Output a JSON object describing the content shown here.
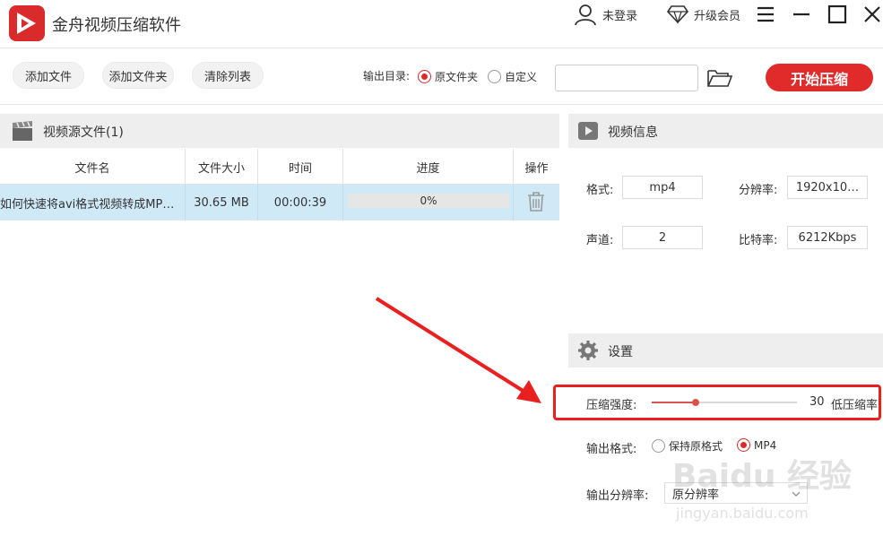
{
  "app": {
    "title": "金舟视频压缩软件"
  },
  "header": {
    "login_label": "未登录",
    "upgrade_label": "升级会员"
  },
  "toolbar": {
    "add_file": "添加文件",
    "add_folder": "添加文件夹",
    "clear_list": "清除列表",
    "output_dir_label": "输出目录:",
    "option_original": "原文件夹",
    "option_custom": "自定义",
    "selected_option": "原文件夹",
    "path_value": "",
    "start_label": "开始压缩"
  },
  "source": {
    "title": "视频源文件(1)",
    "columns": [
      "文件名",
      "文件大小",
      "时间",
      "进度",
      "操作"
    ],
    "rows": [
      {
        "name": "如何快速将avi格式视频转成MP…",
        "size": "30.65 MB",
        "time": "00:00:39",
        "progress": 0,
        "progress_label": "0%"
      }
    ]
  },
  "video_info": {
    "title": "视频信息",
    "format_label": "格式:",
    "format_value": "mp4",
    "resolution_label": "分辨率:",
    "resolution_value": "1920x10…",
    "channel_label": "声道:",
    "channel_value": "2",
    "bitrate_label": "比特率:",
    "bitrate_value": "6212Kbps"
  },
  "settings": {
    "title": "设置",
    "compress_label": "压缩强度:",
    "compress_value": "30",
    "compress_level": 0.3,
    "compress_hint": "低压缩率",
    "output_format_label": "输出格式:",
    "format_keep": "保持原格式",
    "format_mp4": "MP4",
    "selected_format": "MP4",
    "output_res_label": "输出分辨率:",
    "output_res_value": "原分辨率"
  },
  "watermark": {
    "text": "Baidu 经验",
    "url_text": "jingyan.baidu.com"
  },
  "colors": {
    "accent": "#e12b2b",
    "row_selected": "#cfe9f7",
    "panel_header": "#eeeeee"
  }
}
